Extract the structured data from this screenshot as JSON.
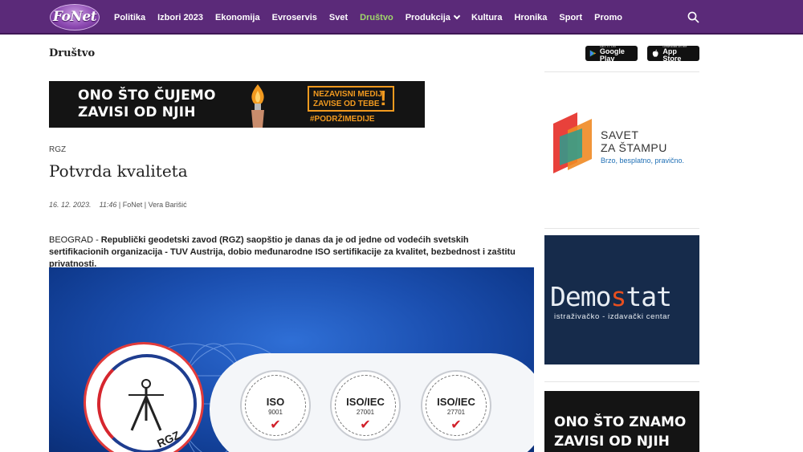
{
  "header": {
    "logo_text": "FoNet",
    "nav": [
      {
        "label": "Politika",
        "active": false
      },
      {
        "label": "Izbori 2023",
        "active": false
      },
      {
        "label": "Ekonomija",
        "active": false
      },
      {
        "label": "Evroservis",
        "active": false
      },
      {
        "label": "Svet",
        "active": false
      },
      {
        "label": "Društvo",
        "active": true
      },
      {
        "label": "Produkcija",
        "active": false,
        "dropdown": true
      },
      {
        "label": "Kultura",
        "active": false
      },
      {
        "label": "Hronika",
        "active": false
      },
      {
        "label": "Sport",
        "active": false
      },
      {
        "label": "Promo",
        "active": false
      }
    ],
    "search_icon": "search-icon",
    "colors": {
      "bar": "#5b2a79",
      "active": "#9fd66a"
    }
  },
  "section": {
    "title": "Društvo"
  },
  "stores": {
    "google": {
      "small": "GET IT ON",
      "big": "Google Play"
    },
    "apple": {
      "small": "Download on the",
      "big": "App Store"
    }
  },
  "banner": {
    "line1": "ONO ŠTO ČUJEMO",
    "line2": "ZAVISI OD NJIH",
    "badge_line1": "NEZAVISNI MEDIJI",
    "badge_line2": "ZAVISE OD TEBE",
    "badge_mark": "!",
    "hashtag": "#PODRŽIMEDIJE",
    "accent": "#f29a1f"
  },
  "article": {
    "tag": "RGZ",
    "title": "Potvrda kvaliteta",
    "date": "16. 12. 2023.",
    "time": "11:46",
    "source": "FoNet",
    "author": "Vera Barišić",
    "location": "BEOGRAD",
    "lead": "Republički geodetski zavod (RGZ) saopštio je danas da je od jedne od vodećih svetskih sertifikacionih organizacija - TUV Austrija, dobio međunarodne ISO sertifikacije za kvalitet, bezbednost i zaštitu privatnosti."
  },
  "hero": {
    "emblem_text": "RGZ",
    "certs": [
      {
        "name": "ISO",
        "num": "9001",
        "check": "✔"
      },
      {
        "name": "ISO/IEC",
        "num": "27001",
        "check": "✔"
      },
      {
        "name": "ISO/IEC",
        "num": "27701",
        "check": "✔"
      }
    ]
  },
  "sidebar": {
    "savet": {
      "line1": "SAVET",
      "line2": "ZA ŠTAMPU",
      "sub": "Brzo, besplatno, pravično."
    },
    "demostat": {
      "title_a": "Demo",
      "title_b": "s",
      "title_c": "tat",
      "sub": "istraživačko - izdavački centar"
    },
    "ad2": {
      "line1": "ONO ŠTO ZNAMO",
      "line2": "ZAVISI OD NJIH"
    }
  }
}
